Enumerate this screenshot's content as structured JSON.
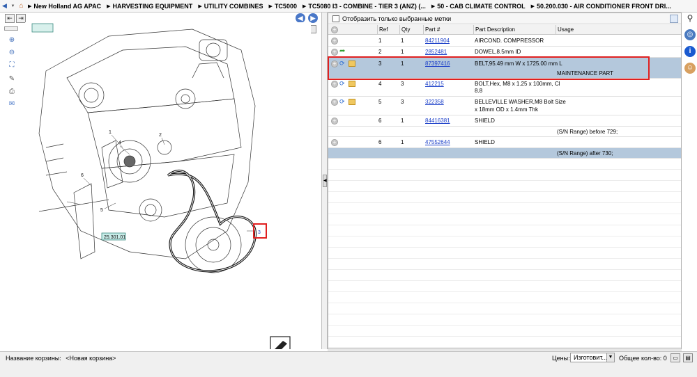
{
  "breadcrumb": [
    "New Holland AG APAC",
    "HARVESTING EQUIPMENT",
    "UTILITY COMBINES",
    "TC5000",
    "TC5080 I3 - COMBINE - TIER 3 (ANZ) (...",
    "50 - CAB CLIMATE CONTROL",
    "50.200.030 - AIR CONDITIONER  FRONT DRI..."
  ],
  "drawing": {
    "label_top": "",
    "label_callout": "25.301.01",
    "ref_labels": [
      "1",
      "2",
      "3",
      "4",
      "5",
      "6"
    ]
  },
  "filter": {
    "label": "Отобразить только выбранные метки"
  },
  "table": {
    "headers": {
      "ref": "Ref",
      "qty": "Qty",
      "part": "Part #",
      "desc": "Part Description",
      "usage": "Usage"
    },
    "rows": [
      {
        "ref": "1",
        "qty": "1",
        "part": "84211904",
        "desc": "AIRCOND. COMPRESSOR",
        "usage": ""
      },
      {
        "ref": "2",
        "qty": "1",
        "part": "2852481",
        "desc": "DOWEL,8.5mm ID",
        "usage": ""
      },
      {
        "ref": "3",
        "qty": "1",
        "part": "87397416",
        "desc": "BELT,95.49 mm W x 1725.00 mm L",
        "usage": "MAINTENANCE PART"
      },
      {
        "ref": "4",
        "qty": "3",
        "part": "412215",
        "desc": "BOLT,Hex, M8 x 1.25 x 100mm, Cl 8.8",
        "desc_line1": "BOLT,Hex, M8 x 1.25 x 100mm, Cl",
        "desc_line2": "8.8",
        "usage": ""
      },
      {
        "ref": "5",
        "qty": "3",
        "part": "322358",
        "desc_line1": "BELLEVILLE WASHER,M8 Bolt Size",
        "desc_line2": "x 18mm OD x 1.4mm Thk",
        "usage": ""
      },
      {
        "ref": "6",
        "qty": "1",
        "part": "84416381",
        "desc": "SHIELD",
        "usage": "(S/N Range) before 729;"
      },
      {
        "ref": "6",
        "qty": "1",
        "part": "47552644",
        "desc": "SHIELD",
        "usage": "(S/N Range) after 730;"
      }
    ]
  },
  "status": {
    "cart_label": "Название корзины:",
    "cart_name": "<Новая корзина>",
    "prices_label": "Цены:",
    "prices_value": "Изготовит...",
    "total_label": "Общее кол-во: 0"
  },
  "colors": {
    "selected_row": "#b4c8dc",
    "link": "#1a3ec8",
    "highlight": "#e02020"
  }
}
